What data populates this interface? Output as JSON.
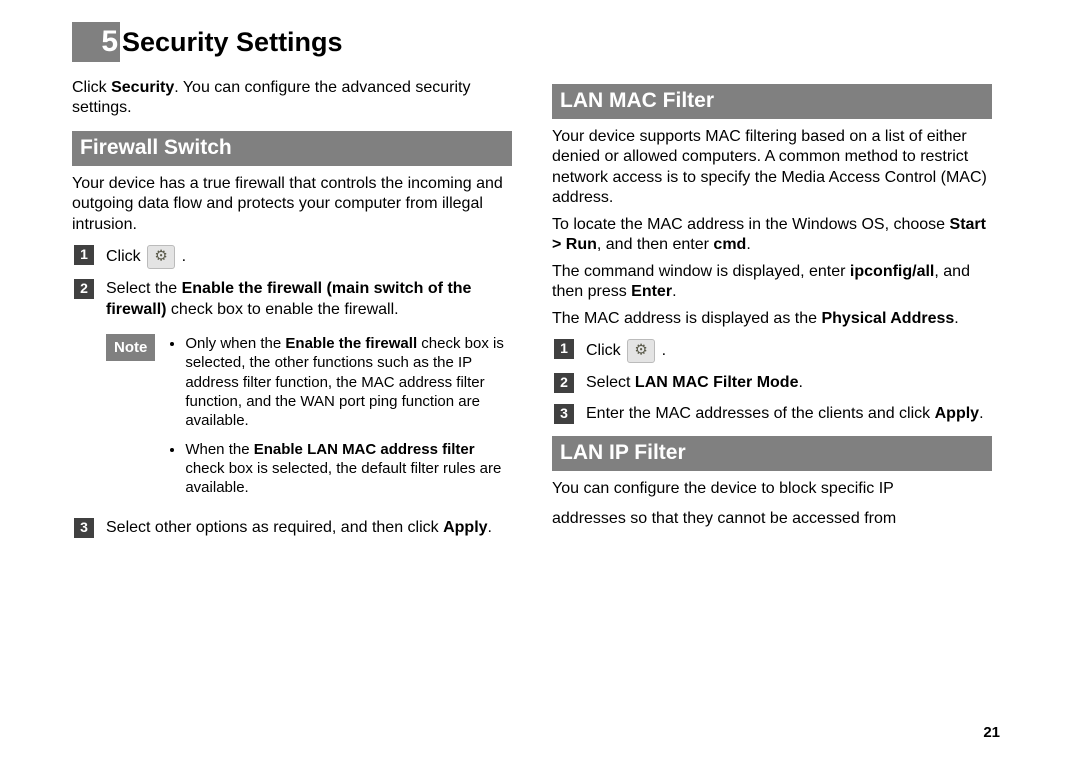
{
  "chapter": {
    "number": "5",
    "title": "Security Settings"
  },
  "intro": {
    "prefix": "Click ",
    "bold": "Security",
    "suffix": ". You can configure the advanced security settings."
  },
  "pageNumber": "21",
  "left": {
    "sectionTitle": "Firewall Switch",
    "para1": "Your device has a true firewall that controls the incoming and outgoing data flow and protects your computer from illegal intrusion.",
    "step1_pre": "Click ",
    "step1_post": " .",
    "step2_pre": "Select the ",
    "step2_bold": "Enable the firewall (main switch of the firewall)",
    "step2_post": " check box to enable the firewall.",
    "noteLabel": "Note",
    "note_b1_a": "Only when the ",
    "note_b1_bold": "Enable the firewall",
    "note_b1_b": " check box is selected, the other functions such as the IP address filter function, the MAC address filter function, and the WAN port ping function are available.",
    "note_b2_a": "When the ",
    "note_b2_bold": "Enable LAN MAC address filter",
    "note_b2_b": " check box is selected, the default filter rules are available.",
    "step3_pre": "Select other options as required, and then click ",
    "step3_bold": "Apply",
    "step3_post": "."
  },
  "right": {
    "section1Title": "LAN MAC Filter",
    "p1": "Your device supports MAC filtering based on a list of either denied or allowed computers. A common method to restrict network access is to specify the Media Access Control (MAC) address.",
    "p2_a": "To locate the MAC address in the Windows OS, choose ",
    "p2_b1": "Start > Run",
    "p2_b": ", and then enter ",
    "p2_b2": "cmd",
    "p2_c": ".",
    "p3_a": "The command window is displayed, enter ",
    "p3_b1": "ipconfig/all",
    "p3_b": ", and then press ",
    "p3_b2": "Enter",
    "p3_c": ".",
    "p4_a": "The MAC address is displayed as the ",
    "p4_b1": "Physical Address",
    "p4_b": ".",
    "step1_pre": "Click ",
    "step1_post": " .",
    "step2_pre": "Select ",
    "step2_bold": "LAN MAC Filter Mode",
    "step2_post": ".",
    "step3_pre": "Enter the MAC addresses of the clients and click ",
    "step3_bold": "Apply",
    "step3_post": ".",
    "section2Title": "LAN IP Filter",
    "p5_a": "You can configure the device to block specific IP",
    "p5_b": "addresses so that they cannot be accessed from"
  }
}
